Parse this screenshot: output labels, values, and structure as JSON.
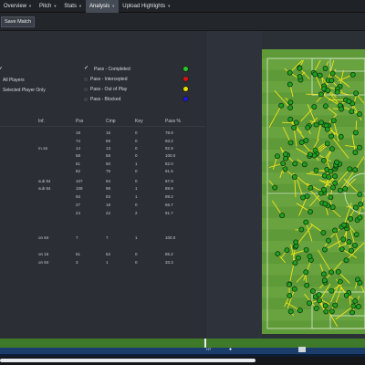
{
  "menu": [
    {
      "label": "Overview"
    },
    {
      "label": "Pitch"
    },
    {
      "label": "Stats"
    },
    {
      "label": "Analysis"
    },
    {
      "label": "Upload Highlights"
    }
  ],
  "toolbar": {
    "save_label": "Save Match"
  },
  "filters": {
    "all_players": "All Players",
    "selected_player_only": "Selected Player Only"
  },
  "legend": [
    {
      "label": "Pass - Completed",
      "color": "#22cc22",
      "checked": true
    },
    {
      "label": "Pass - Intercepted",
      "color": "#e01010",
      "checked": false
    },
    {
      "label": "Pass - Out of Play",
      "color": "#e8e000",
      "checked": false
    },
    {
      "label": "Pass - Blocked",
      "color": "#1a1ad0",
      "checked": false
    }
  ],
  "table": {
    "headers": [
      "Inf.",
      "Pss",
      "Cmp",
      "Key",
      "Pass %"
    ],
    "rows": [
      {
        "inf": "",
        "pss": "19",
        "cmp": "15",
        "key": "0",
        "pct": "78.9"
      },
      {
        "inf": "",
        "pss": "74",
        "cmp": "69",
        "key": "0",
        "pct": "93.2"
      },
      {
        "inf": "m.16",
        "pss": "14",
        "cmp": "13",
        "key": "0",
        "pct": "92.9"
      },
      {
        "inf": "",
        "pss": "58",
        "cmp": "58",
        "key": "0",
        "pct": "100.0"
      },
      {
        "inf": "",
        "pss": "61",
        "cmp": "50",
        "key": "1",
        "pct": "82.0"
      },
      {
        "inf": "",
        "pss": "82",
        "cmp": "75",
        "key": "0",
        "pct": "91.5"
      },
      {
        "inf": "sub 84",
        "pss": "107",
        "cmp": "94",
        "key": "0",
        "pct": "87.9"
      },
      {
        "inf": "sub 84",
        "pss": "109",
        "cmp": "98",
        "key": "1",
        "pct": "89.9"
      },
      {
        "inf": "",
        "pss": "93",
        "cmp": "83",
        "key": "1",
        "pct": "89.2"
      },
      {
        "inf": "",
        "pss": "27",
        "cmp": "18",
        "key": "0",
        "pct": "66.7"
      },
      {
        "inf": "",
        "pss": "24",
        "cmp": "22",
        "key": "2",
        "pct": "91.7"
      },
      {
        "inf": "on 84",
        "pss": "7",
        "cmp": "7",
        "key": "1",
        "pct": "100.0"
      },
      {
        "inf": "on 16",
        "pss": "61",
        "cmp": "52",
        "key": "0",
        "pct": "85.2"
      },
      {
        "inf": "on 84",
        "pss": "3",
        "cmp": "1",
        "key": "0",
        "pct": "33.3"
      }
    ]
  },
  "timeline": {
    "marker_label": "HT",
    "progress": 0.7
  }
}
